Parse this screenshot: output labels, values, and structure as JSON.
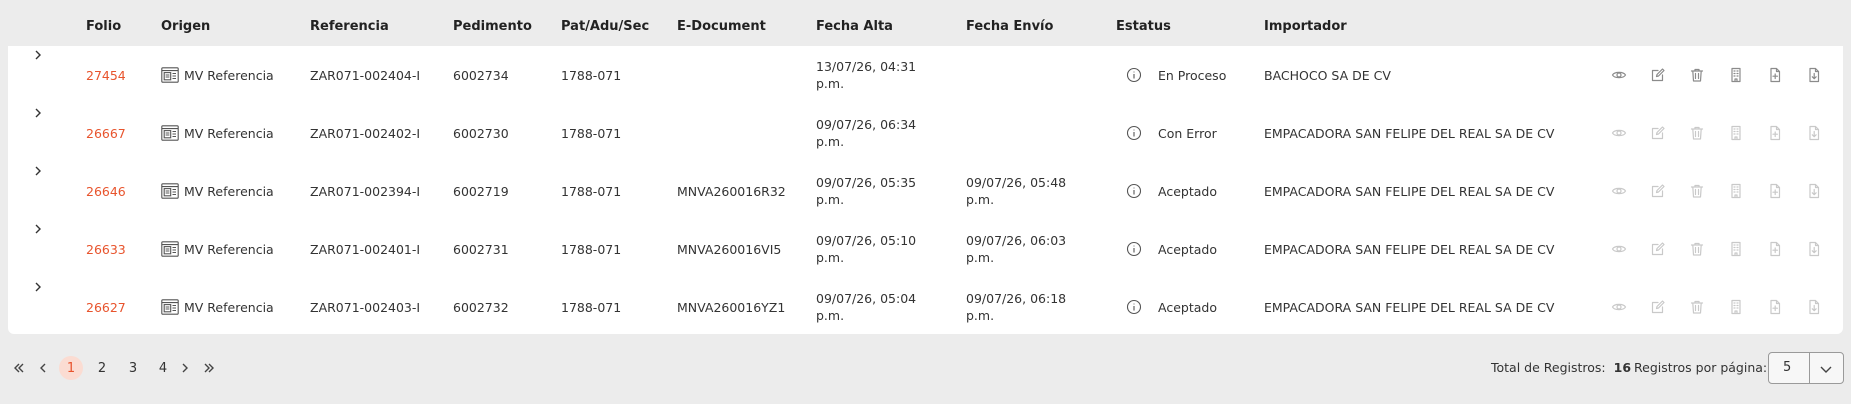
{
  "table": {
    "headers": {
      "folio": "Folio",
      "origen": "Origen",
      "referencia": "Referencia",
      "pedimento": "Pedimento",
      "pat": "Pat/Adu/Sec",
      "edoc": "E-Document",
      "fecha_alta": "Fecha Alta",
      "fecha_envio": "Fecha Envío",
      "estatus": "Estatus",
      "importador": "Importador"
    },
    "rows": [
      {
        "folio": "27454",
        "origen": "MV Referencia",
        "referencia": "ZAR071-002404-I",
        "pedimento": "6002734",
        "pat": "1788-071",
        "edoc": "",
        "fecha_alta": "13/07/26, 04:31 p.m.",
        "fecha_envio": "",
        "estatus": "En Proceso",
        "importador": "BACHOCO SA DE CV",
        "actions_enabled": true
      },
      {
        "folio": "26667",
        "origen": "MV Referencia",
        "referencia": "ZAR071-002402-I",
        "pedimento": "6002730",
        "pat": "1788-071",
        "edoc": "",
        "fecha_alta": "09/07/26, 06:34 p.m.",
        "fecha_envio": "",
        "estatus": "Con Error",
        "importador": "EMPACADORA SAN FELIPE DEL REAL SA DE CV",
        "actions_enabled": false
      },
      {
        "folio": "26646",
        "origen": "MV Referencia",
        "referencia": "ZAR071-002394-I",
        "pedimento": "6002719",
        "pat": "1788-071",
        "edoc": "MNVA260016R32",
        "fecha_alta": "09/07/26, 05:35 p.m.",
        "fecha_envio": "09/07/26, 05:48 p.m.",
        "estatus": "Aceptado",
        "importador": "EMPACADORA SAN FELIPE DEL REAL SA DE CV",
        "actions_enabled": false
      },
      {
        "folio": "26633",
        "origen": "MV Referencia",
        "referencia": "ZAR071-002401-I",
        "pedimento": "6002731",
        "pat": "1788-071",
        "edoc": "MNVA260016VI5",
        "fecha_alta": "09/07/26, 05:10 p.m.",
        "fecha_envio": "09/07/26, 06:03 p.m.",
        "estatus": "Aceptado",
        "importador": "EMPACADORA SAN FELIPE DEL REAL SA DE CV",
        "actions_enabled": false
      },
      {
        "folio": "26627",
        "origen": "MV Referencia",
        "referencia": "ZAR071-002403-I",
        "pedimento": "6002732",
        "pat": "1788-071",
        "edoc": "MNVA260016YZ1",
        "fecha_alta": "09/07/26, 05:04 p.m.",
        "fecha_envio": "09/07/26, 06:18 p.m.",
        "estatus": "Aceptado",
        "importador": "EMPACADORA SAN FELIPE DEL REAL SA DE CV",
        "actions_enabled": false
      }
    ],
    "row_actions": [
      "eye-icon",
      "edit-icon",
      "trash-icon",
      "building-icon",
      "file-plus-icon",
      "file-download-icon"
    ]
  },
  "pagination": {
    "pages": [
      "1",
      "2",
      "3",
      "4"
    ],
    "current": "1",
    "total_label": "Total de Registros:",
    "total_value": "16",
    "per_page_label": "Registros por página:",
    "per_page_value": "5"
  },
  "colors": {
    "accent": "#e8542d",
    "active_page_bg": "#fbdcd2",
    "header_bg": "#ececec"
  }
}
